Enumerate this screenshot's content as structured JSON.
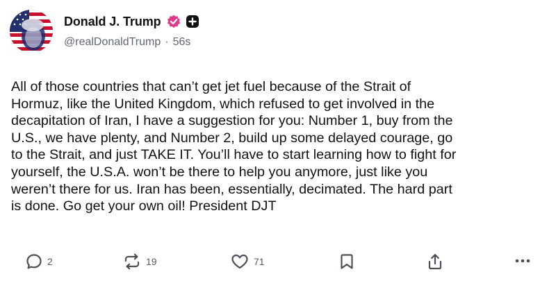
{
  "author": {
    "display_name": "Donald J. Trump",
    "handle": "@realDonaldTrump",
    "separator": "·",
    "time_ago": "56s",
    "verified_color": "#e03a8a"
  },
  "post": {
    "text": "All of those countries that can’t get jet fuel because of the Strait of\nHormuz, like the United Kingdom, which refused to get involved in the\ndecapitation of Iran, I have a suggestion for you: Number 1, buy from the\nU.S., we have plenty, and Number 2, build up some delayed courage, go\nto the Strait, and just TAKE IT. You’ll have to start learning how to fight for\nyourself, the U.S.A. won’t be there to help you anymore, just like you\nweren’t there for us. Iran has been, essentially, decimated. The hard part\nis done. Go get your own oil! President DJT"
  },
  "actions": {
    "reply_count": "2",
    "repost_count": "19",
    "like_count": "71",
    "icons": [
      "reply-icon",
      "repost-icon",
      "like-icon",
      "bookmark-icon",
      "share-icon",
      "more-icon"
    ]
  }
}
